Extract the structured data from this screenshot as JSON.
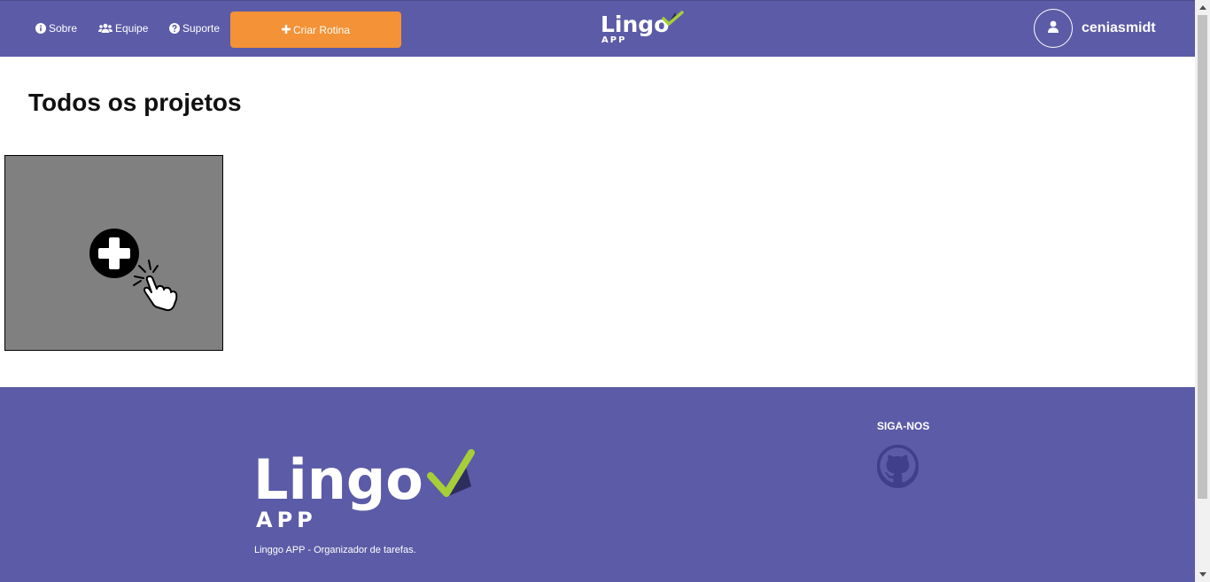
{
  "header": {
    "nav": [
      {
        "label": "Sobre",
        "icon": "info-circle-icon"
      },
      {
        "label": "Equipe",
        "icon": "users-icon"
      },
      {
        "label": "Suporte",
        "icon": "question-circle-icon"
      }
    ],
    "create_button": {
      "label": "Criar Rotina",
      "icon": "plus-icon"
    },
    "logo": {
      "word": "Lingo",
      "sub": "APP"
    },
    "user": {
      "name": "ceniasmidt",
      "icon": "user-icon"
    }
  },
  "main": {
    "title": "Todos os projetos",
    "new_project_card": {
      "icon": "add-click-icon"
    }
  },
  "footer": {
    "logo": {
      "word": "Lingo",
      "sub": "APP"
    },
    "tagline": "Linggo APP - Organizador de tarefas.",
    "follow_title": "SIGA-NOS",
    "social": [
      {
        "icon": "github-icon"
      }
    ]
  },
  "colors": {
    "brand_purple": "#5b5ba7",
    "accent_orange": "#f39236",
    "check_green": "#a6ce39",
    "card_gray": "#808080"
  }
}
